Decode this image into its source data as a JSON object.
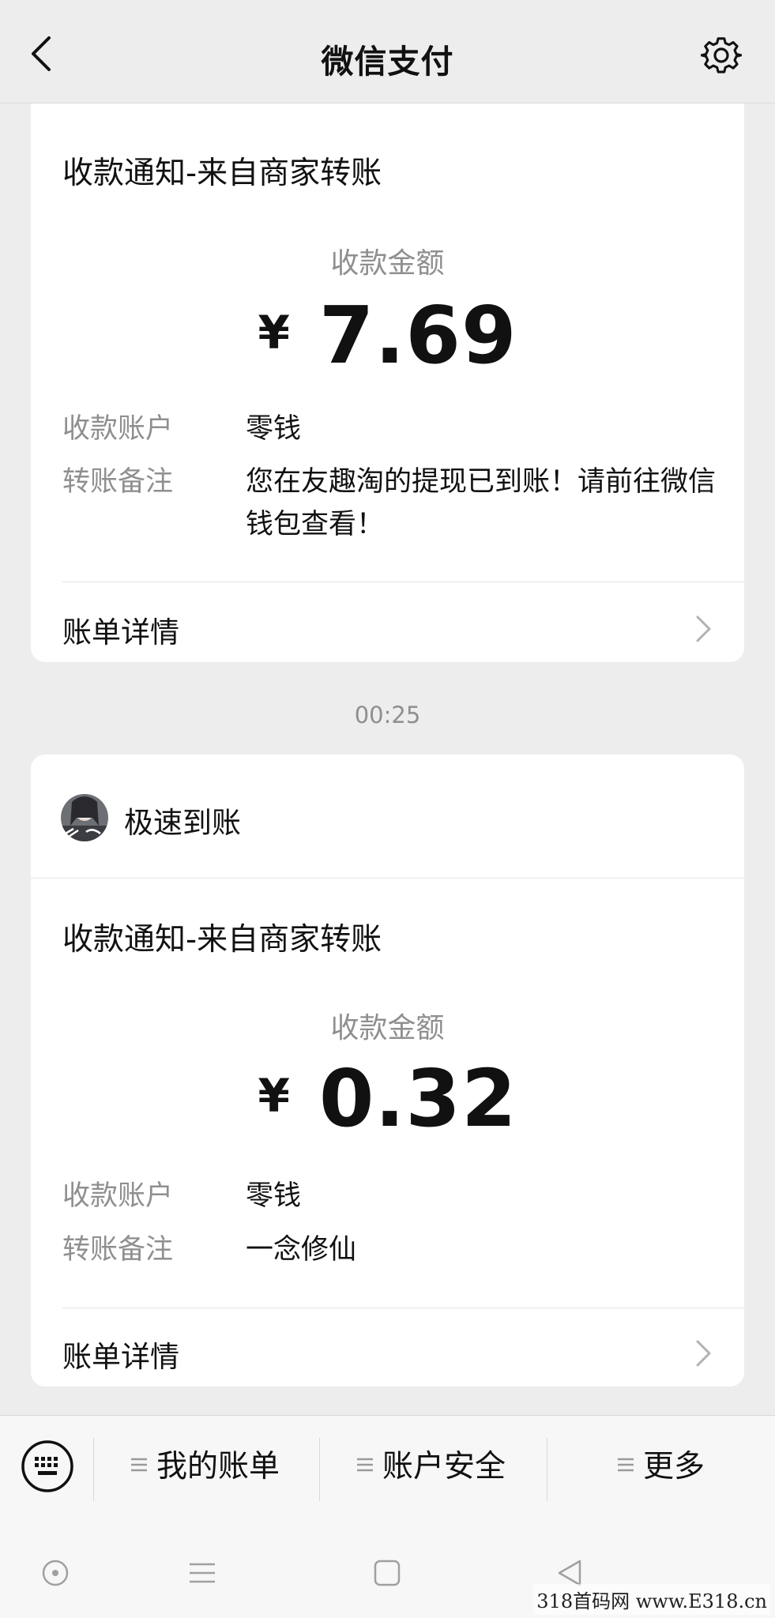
{
  "header": {
    "title": "微信支付",
    "back_icon": "back-chevron-icon",
    "settings_icon": "gear-icon"
  },
  "messages": [
    {
      "title": "收款通知-来自商家转账",
      "amount_label": "收款金额",
      "currency": "¥",
      "amount": "7.69",
      "account_label": "收款账户",
      "account_value": "零钱",
      "remark_label": "转账备注",
      "remark_value": "您在友趣淘的提现已到账！请前往微信钱包查看！",
      "detail_label": "账单详情"
    },
    {
      "sender": "极速到账",
      "title": "收款通知-来自商家转账",
      "amount_label": "收款金额",
      "currency": "¥",
      "amount": "0.32",
      "account_label": "收款账户",
      "account_value": "零钱",
      "remark_label": "转账备注",
      "remark_value": "一念修仙",
      "detail_label": "账单详情"
    }
  ],
  "timestamp": "00:25",
  "bottom_menu": {
    "keyboard_icon": "keyboard-icon",
    "items": [
      "我的账单",
      "账户安全",
      "更多"
    ]
  },
  "system_nav": [
    "circle-icon",
    "menu-lines-icon",
    "square-icon",
    "triangle-back-icon"
  ],
  "watermark": "318首码网 www.E318.cn",
  "colors": {
    "background": "#ededed",
    "card": "#ffffff",
    "secondary_text": "#8f8f8f"
  }
}
